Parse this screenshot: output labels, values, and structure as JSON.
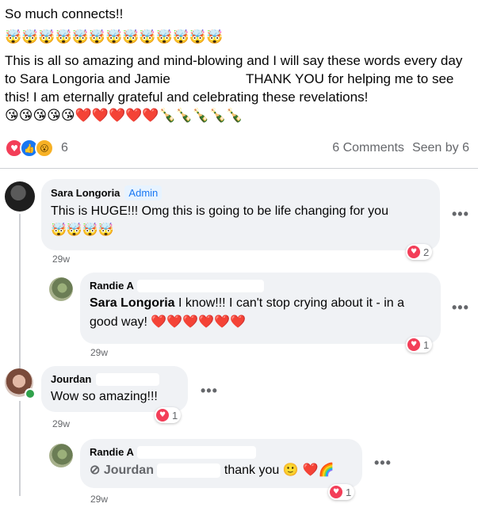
{
  "post": {
    "line1": "So much connects!!",
    "line2_emojis": "🤯🤯🤯🤯🤯🤯🤯🤯🤯🤯🤯🤯🤯",
    "body": "This is all so amazing and mind-blowing and I will say these words every day to Sara Longoria and Jamie",
    "body_cont": "THANK YOU for helping me to see this! I am eternally grateful and celebrating these revelations!",
    "body_emojis": "😘😘😘😘😘❤️❤️❤️❤️❤️🍾🍾🍾🍾🍾"
  },
  "reactions": {
    "icons": [
      "love-icon",
      "like-icon",
      "wow-icon"
    ],
    "count": "6",
    "comments": "6 Comments",
    "seen_by": "Seen by 6"
  },
  "comments": [
    {
      "name": "Sara Longoria",
      "badge": "Admin",
      "text": "This is HUGE!!! Omg this is going to be life changing for you",
      "emojis": "🤯🤯🤯🤯",
      "time": "29w",
      "reaction_count": "2"
    },
    {
      "name": "Randie A",
      "mention": "Sara Longoria",
      "text": "I know!!! I can't stop crying about it - in a good way!",
      "emojis": "❤️❤️❤️❤️❤️❤️",
      "time": "29w",
      "reaction_count": "1"
    },
    {
      "name": "Jourdan",
      "text": "Wow so amazing!!!",
      "time": "29w",
      "reaction_count": "1"
    },
    {
      "name": "Randie A",
      "mention": "Jourdan",
      "text": "thank you",
      "emojis": "🙂 ❤️🌈",
      "time": "29w",
      "reaction_count": "1"
    }
  ],
  "ui": {
    "more_label": "•••",
    "heart_glyph": "♥",
    "like_glyph": "👍",
    "wow_glyph": "😮",
    "mention_icon": "⊘"
  }
}
